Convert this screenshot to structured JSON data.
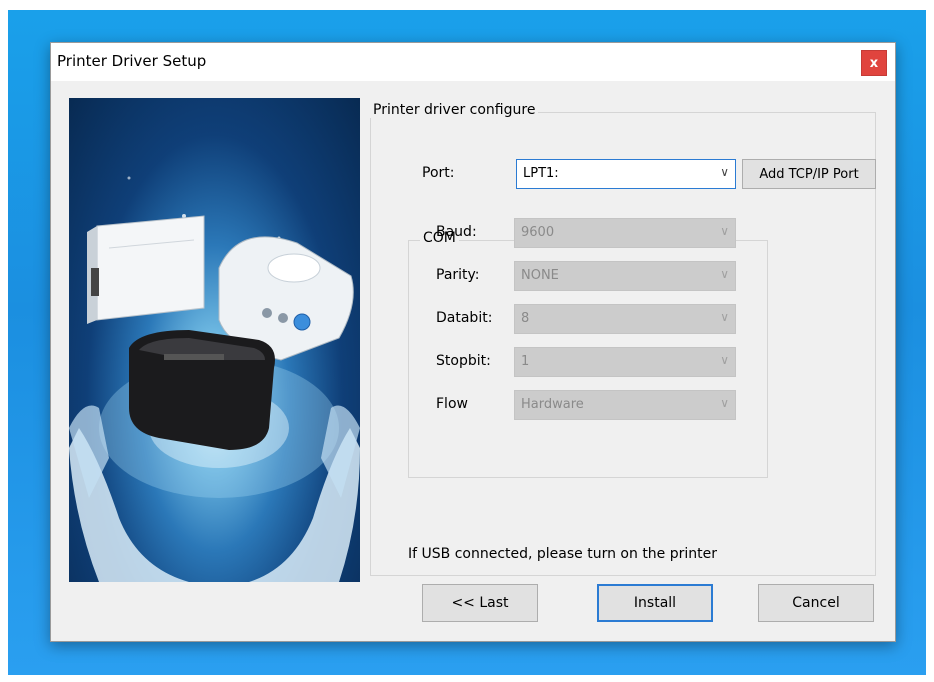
{
  "window": {
    "title": "Printer Driver Setup",
    "close_label": "x"
  },
  "config": {
    "group_label": "Printer driver configure",
    "port": {
      "label": "Port:",
      "value": "LPT1:"
    },
    "add_tcp_label": "Add TCP/IP Port"
  },
  "com": {
    "group_label": "COM",
    "fields": [
      {
        "label": "Baud:",
        "value": "9600"
      },
      {
        "label": "Parity:",
        "value": "NONE"
      },
      {
        "label": "Databit:",
        "value": "8"
      },
      {
        "label": "Stopbit:",
        "value": "1"
      },
      {
        "label": "Flow",
        "value": "Hardware"
      }
    ]
  },
  "hint": "If USB connected, please turn on the printer",
  "buttons": {
    "last": "<< Last",
    "install": "Install",
    "cancel": "Cancel"
  },
  "colors": {
    "desktop": "#1b8fe0",
    "close": "#e0443e",
    "focus": "#2b7bd3"
  }
}
